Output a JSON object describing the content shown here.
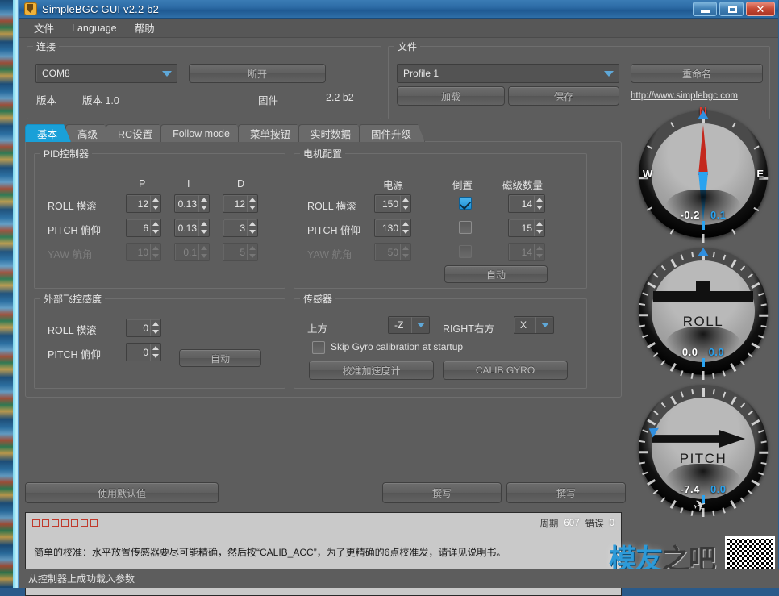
{
  "window": {
    "title": "SimpleBGC GUI v2.2 b2",
    "icon": "java-coffee-icon",
    "controls": {
      "minimize": "minimize-icon",
      "maximize": "maximize-icon",
      "close": "close-icon"
    }
  },
  "menubar": {
    "items": [
      "文件",
      "Language",
      "帮助"
    ]
  },
  "connection": {
    "legend": "连接",
    "port_value": "COM8",
    "disconnect_label": "断开",
    "version_label": "版本",
    "version_value": "版本 1.0",
    "firmware_label": "固件",
    "firmware_value": "2.2 b2"
  },
  "file": {
    "legend": "文件",
    "profile_value": "Profile 1",
    "rename_label": "重命名",
    "load_label": "加载",
    "save_label": "保存",
    "link": "http://www.simplebgc.com"
  },
  "tabs": [
    {
      "label": "基本",
      "active": true
    },
    {
      "label": "高级",
      "active": false
    },
    {
      "label": "RC设置",
      "active": false
    },
    {
      "label": "Follow mode",
      "active": false
    },
    {
      "label": "菜单按钮",
      "active": false
    },
    {
      "label": "实时数据",
      "active": false
    },
    {
      "label": "固件升级",
      "active": false
    }
  ],
  "pid": {
    "legend": "PID控制器",
    "columns": [
      "P",
      "I",
      "D"
    ],
    "rows": [
      {
        "axis": "ROLL 横滚",
        "p": "12",
        "i": "0.13",
        "d": "12",
        "disabled": false
      },
      {
        "axis": "PITCH 俯仰",
        "p": "6",
        "i": "0.13",
        "d": "3",
        "disabled": false
      },
      {
        "axis": "YAW 航角",
        "p": "10",
        "i": "0.1",
        "d": "5",
        "disabled": true
      }
    ]
  },
  "motor": {
    "legend": "电机配置",
    "columns": [
      "电源",
      "倒置",
      "磁级数量"
    ],
    "rows": [
      {
        "axis": "ROLL 横滚",
        "power": "150",
        "invert": true,
        "poles": "14",
        "disabled": false
      },
      {
        "axis": "PITCH 俯仰",
        "power": "130",
        "invert": false,
        "poles": "15",
        "disabled": false
      },
      {
        "axis": "YAW 航角",
        "power": "50",
        "invert": false,
        "poles": "14",
        "disabled": true
      }
    ],
    "auto_label": "自动"
  },
  "external_fc": {
    "legend": "外部飞控感度",
    "rows": [
      {
        "axis": "ROLL 横滚",
        "value": "0"
      },
      {
        "axis": "PITCH 俯仰",
        "value": "0"
      }
    ],
    "auto_label": "自动"
  },
  "sensor": {
    "legend": "传感器",
    "top_label": "上方",
    "top_value": "-Z",
    "right_label": "RIGHT右方",
    "right_value": "X",
    "skip_gyro_label": "Skip Gyro calibration at startup",
    "skip_gyro_checked": false,
    "calib_acc_label": "校准加速度计",
    "calib_gyro_label": "CALIB.GYRO"
  },
  "bottom_buttons": {
    "defaults_label": "使用默认值",
    "write1_label": "撰写",
    "write2_label": "撰写"
  },
  "console": {
    "cycle_label": "周期",
    "cycle_value": "607",
    "error_label": "错误",
    "error_value": "0",
    "message": "简单的校准：水平放置传感器要尽可能精确，然后按“CALIB_ACC”，为了更精确的6点校准发，请详见说明书。"
  },
  "statusbar": {
    "text": "从控制器上成功载入参数"
  },
  "gauges": [
    {
      "name": "yaw",
      "label": "",
      "white_value": "-0.2",
      "blue_value": "0.1",
      "cardinal_w": "W",
      "cardinal_e": "E",
      "cardinal_n": "N"
    },
    {
      "name": "roll",
      "label": "ROLL",
      "white_value": "0.0",
      "blue_value": "0.0"
    },
    {
      "name": "pitch",
      "label": "PITCH",
      "white_value": "-7.4",
      "blue_value": "0.0"
    }
  ],
  "watermark": {
    "text1": "模友",
    "text2": "之吧",
    "url": "http://www.moz8.com"
  },
  "colors": {
    "accent": "#1aa0d8",
    "blue_value": "#2aa3f0",
    "needle_red": "#c4281d",
    "panel": "#5d5d5d"
  }
}
